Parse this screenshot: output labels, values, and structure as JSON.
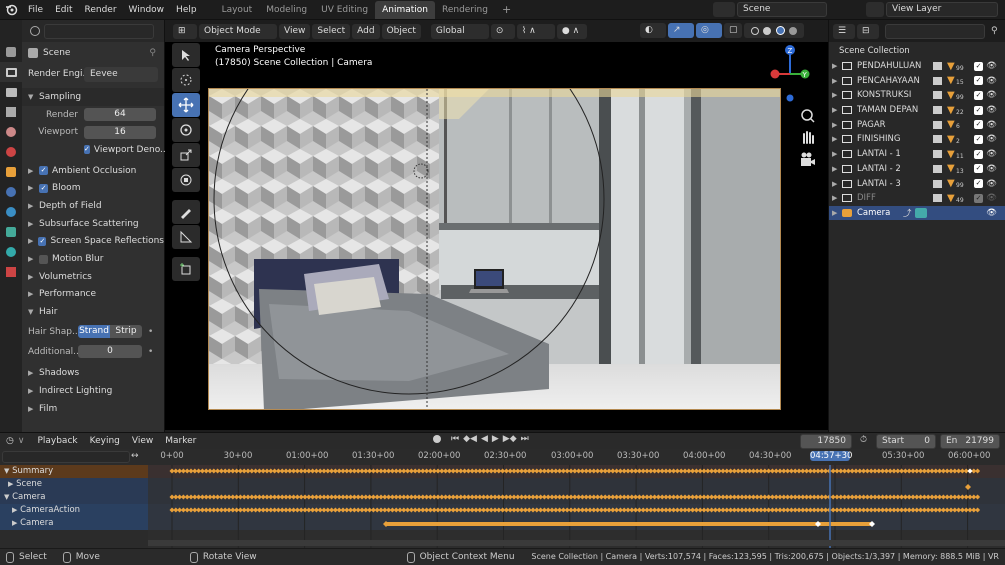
{
  "top_menu": {
    "items": [
      "File",
      "Edit",
      "Render",
      "Window",
      "Help"
    ],
    "workspaces": [
      "Layout",
      "Modeling",
      "UV Editing",
      "Animation",
      "Rendering"
    ],
    "active_workspace": "Animation",
    "add_tab": "+",
    "scene": "Scene",
    "view_layer": "View Layer"
  },
  "viewport_header": {
    "mode": "Object Mode",
    "menus": [
      "View",
      "Select",
      "Add",
      "Object"
    ],
    "orientation": "Global"
  },
  "viewport": {
    "title": "Camera Perspective",
    "subtitle": "(17850) Scene Collection | Camera"
  },
  "properties": {
    "object_name": "Scene",
    "render_engine_label": "Render Engi...",
    "render_engine_value": "Eevee",
    "sampling_label": "Sampling",
    "render_label": "Render",
    "render_value": "64",
    "viewport_label": "Viewport",
    "viewport_value": "16",
    "viewport_denoise": "Viewport Deno...",
    "ambient_occlusion": "Ambient Occlusion",
    "bloom": "Bloom",
    "depth_of_field": "Depth of Field",
    "subsurface": "Subsurface Scattering",
    "ssr": "Screen Space Reflections",
    "motion_blur": "Motion Blur",
    "volumetrics": "Volumetrics",
    "performance": "Performance",
    "hair": "Hair",
    "hair_shape_label": "Hair Shap...",
    "strand": "Strand",
    "strip": "Strip",
    "additional_label": "Additional...",
    "additional_value": "0",
    "shadows": "Shadows",
    "indirect_lighting": "Indirect Lighting",
    "film": "Film"
  },
  "outliner": {
    "root": "Scene Collection",
    "items": [
      {
        "name": "PENDAHULUAN",
        "badge": "99"
      },
      {
        "name": "PENCAHAYAAN",
        "badge": "15"
      },
      {
        "name": "KONSTRUKSI",
        "badge": "99"
      },
      {
        "name": "TAMAN DEPAN",
        "badge": "22"
      },
      {
        "name": "PAGAR",
        "badge": "6"
      },
      {
        "name": "FINISHING",
        "badge": "2"
      },
      {
        "name": "LANTAI - 1",
        "badge": "11"
      },
      {
        "name": "LANTAI - 2",
        "badge": "13"
      },
      {
        "name": "LANTAI - 3",
        "badge": "99"
      },
      {
        "name": "DIFF",
        "badge": "49"
      }
    ],
    "camera": "Camera"
  },
  "timeline": {
    "menus": [
      "Playback",
      "Keying",
      "View",
      "Marker"
    ],
    "current_frame": "17850",
    "start_label": "Start",
    "start_value": "0",
    "end_label": "En",
    "end_value": "21799",
    "ruler": [
      "0+00",
      "30+00",
      "01:00+00",
      "01:30+00",
      "02:00+00",
      "02:30+00",
      "03:00+00",
      "03:30+00",
      "04:00+00",
      "04:30+00",
      "04:57+30",
      "05:30+00",
      "06:00+00"
    ],
    "channels": [
      "Summary",
      "Scene",
      "Camera",
      "CameraAction",
      "Camera"
    ]
  },
  "statusbar": {
    "select": "Select",
    "move": "Move",
    "rotate": "Rotate View",
    "context": "Object Context Menu",
    "info": "Scene Collection | Camera | Verts:107,574 | Faces:123,595 | Tris:200,675 | Objects:1/3,397 | Memory: 888.5 MiB | VR"
  },
  "colors": {
    "accent": "#4772b3",
    "keyframe": "#e8a03a",
    "playhead": "#4772b3"
  }
}
